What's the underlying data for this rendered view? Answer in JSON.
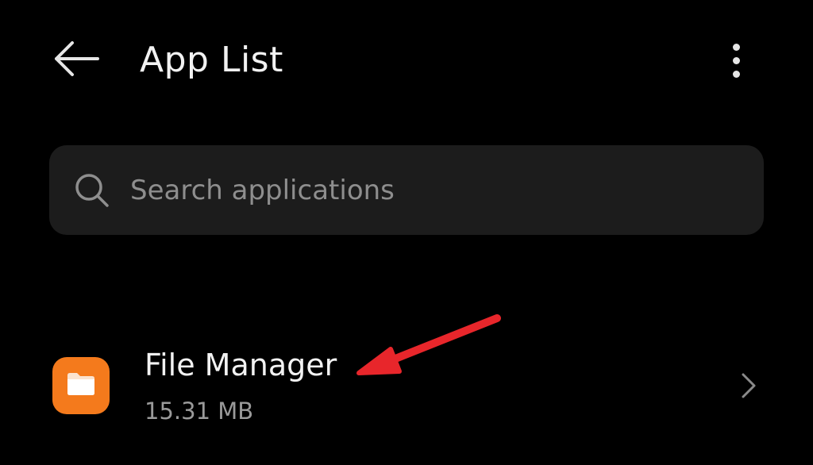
{
  "header": {
    "title": "App List",
    "back_icon": "arrow-left-icon",
    "more_icon": "more-vertical-icon"
  },
  "search": {
    "placeholder": "Search applications",
    "value": "",
    "icon": "search-icon"
  },
  "apps": [
    {
      "name": "File Manager",
      "size": "15.31 MB",
      "icon": "folder-icon",
      "icon_color": "#f47a1c"
    }
  ],
  "annotation": {
    "color": "#e8262b",
    "icon": "red-arrow-annotation"
  },
  "colors": {
    "background": "#000000",
    "search_bg": "#1c1c1c",
    "text_primary": "#f2f2f2",
    "text_secondary": "#9a9a9a"
  }
}
